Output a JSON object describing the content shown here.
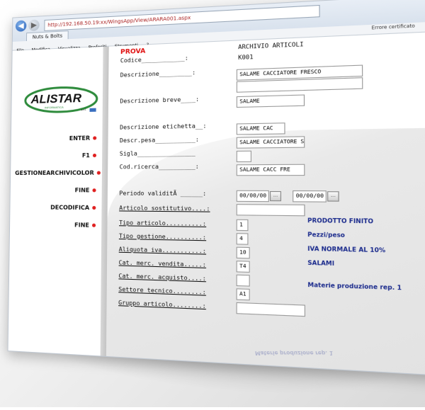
{
  "browser": {
    "url": "http://192.168.50.19:xx/WingsApp/View/ARARA001.aspx",
    "tab_title": "Nuts & Bolts",
    "menu": [
      "File",
      "Modifica",
      "Visualizza",
      "Preferiti",
      "Strumenti",
      "?"
    ],
    "status_text": "Errore certificato"
  },
  "sidebar": {
    "logo_text": "ALISTAR",
    "logo_sub": "INFORMATICA",
    "logo_srl": "s.r.l.",
    "items": [
      {
        "label": "ENTER"
      },
      {
        "label": "F1"
      },
      {
        "label": "GESTIONEARCHIVICOLOR"
      },
      {
        "label": "FINE"
      },
      {
        "label": "DECODIFICA"
      },
      {
        "label": "FINE"
      }
    ]
  },
  "form": {
    "title": "PROVA",
    "header": "ARCHIVIO ARTICOLI",
    "labels": {
      "codice": "Codice____________:",
      "descrizione": "Descrizione_________:",
      "descrizione_breve": "Descrizione breve____:",
      "descrizione_etichetta": "Descrizione etichetta__:",
      "descr_pesa": "Descr.pesa___________:",
      "sigla": "Sigla________________",
      "cod_ricerca": "Cod.ricerca__________:",
      "periodo_validita": "Periodo validitÃ ______:",
      "articolo_sostitutivo": "Articolo sostitutivo....:",
      "tipo_articolo": "Tipo articolo..........:",
      "tipo_gestione": "Tipo gestione..........:",
      "aliquota_iva": "Aliquota iva...........:",
      "cat_merc_vendita": "Cat. merc. vendita.....:",
      "cat_merc_acquisto": "Cat. merc. acquisto....:",
      "settore_tecnico": "Settore tecnico........:",
      "gruppo_articolo": "Gruppo articolo........:"
    },
    "values": {
      "codice": "K001",
      "descrizione": "SALAME CACCIATORE FRESCO",
      "descrizione_2": "",
      "descrizione_breve": "SALAME",
      "descrizione_etichetta": "SALAME CAC",
      "descr_pesa": "SALAME CACCIATORE SC",
      "sigla": "",
      "cod_ricerca": "SALAME CACC FRE",
      "periodo_da": "00/00/00",
      "periodo_a": "00/00/00",
      "articolo_sostitutivo": "",
      "tipo_articolo": "1",
      "tipo_gestione": "4",
      "aliquota_iva": "10",
      "cat_merc_vendita": "T4",
      "cat_merc_acquisto": "",
      "settore_tecnico": "A1",
      "gruppo_articolo": ""
    },
    "decodes": {
      "tipo_articolo": "PRODOTTO FINITO",
      "tipo_gestione": "Pezzi/peso",
      "aliquota_iva": "IVA NORMALE AL 10%",
      "cat_merc_vendita": "SALAMI",
      "settore_tecnico": "Materie produzione rep. 1"
    },
    "lookup_button": "..."
  },
  "colors": {
    "accent_red": "#e01010",
    "decode_blue": "#1a2a8c",
    "logo_green": "#2e8b3c"
  }
}
